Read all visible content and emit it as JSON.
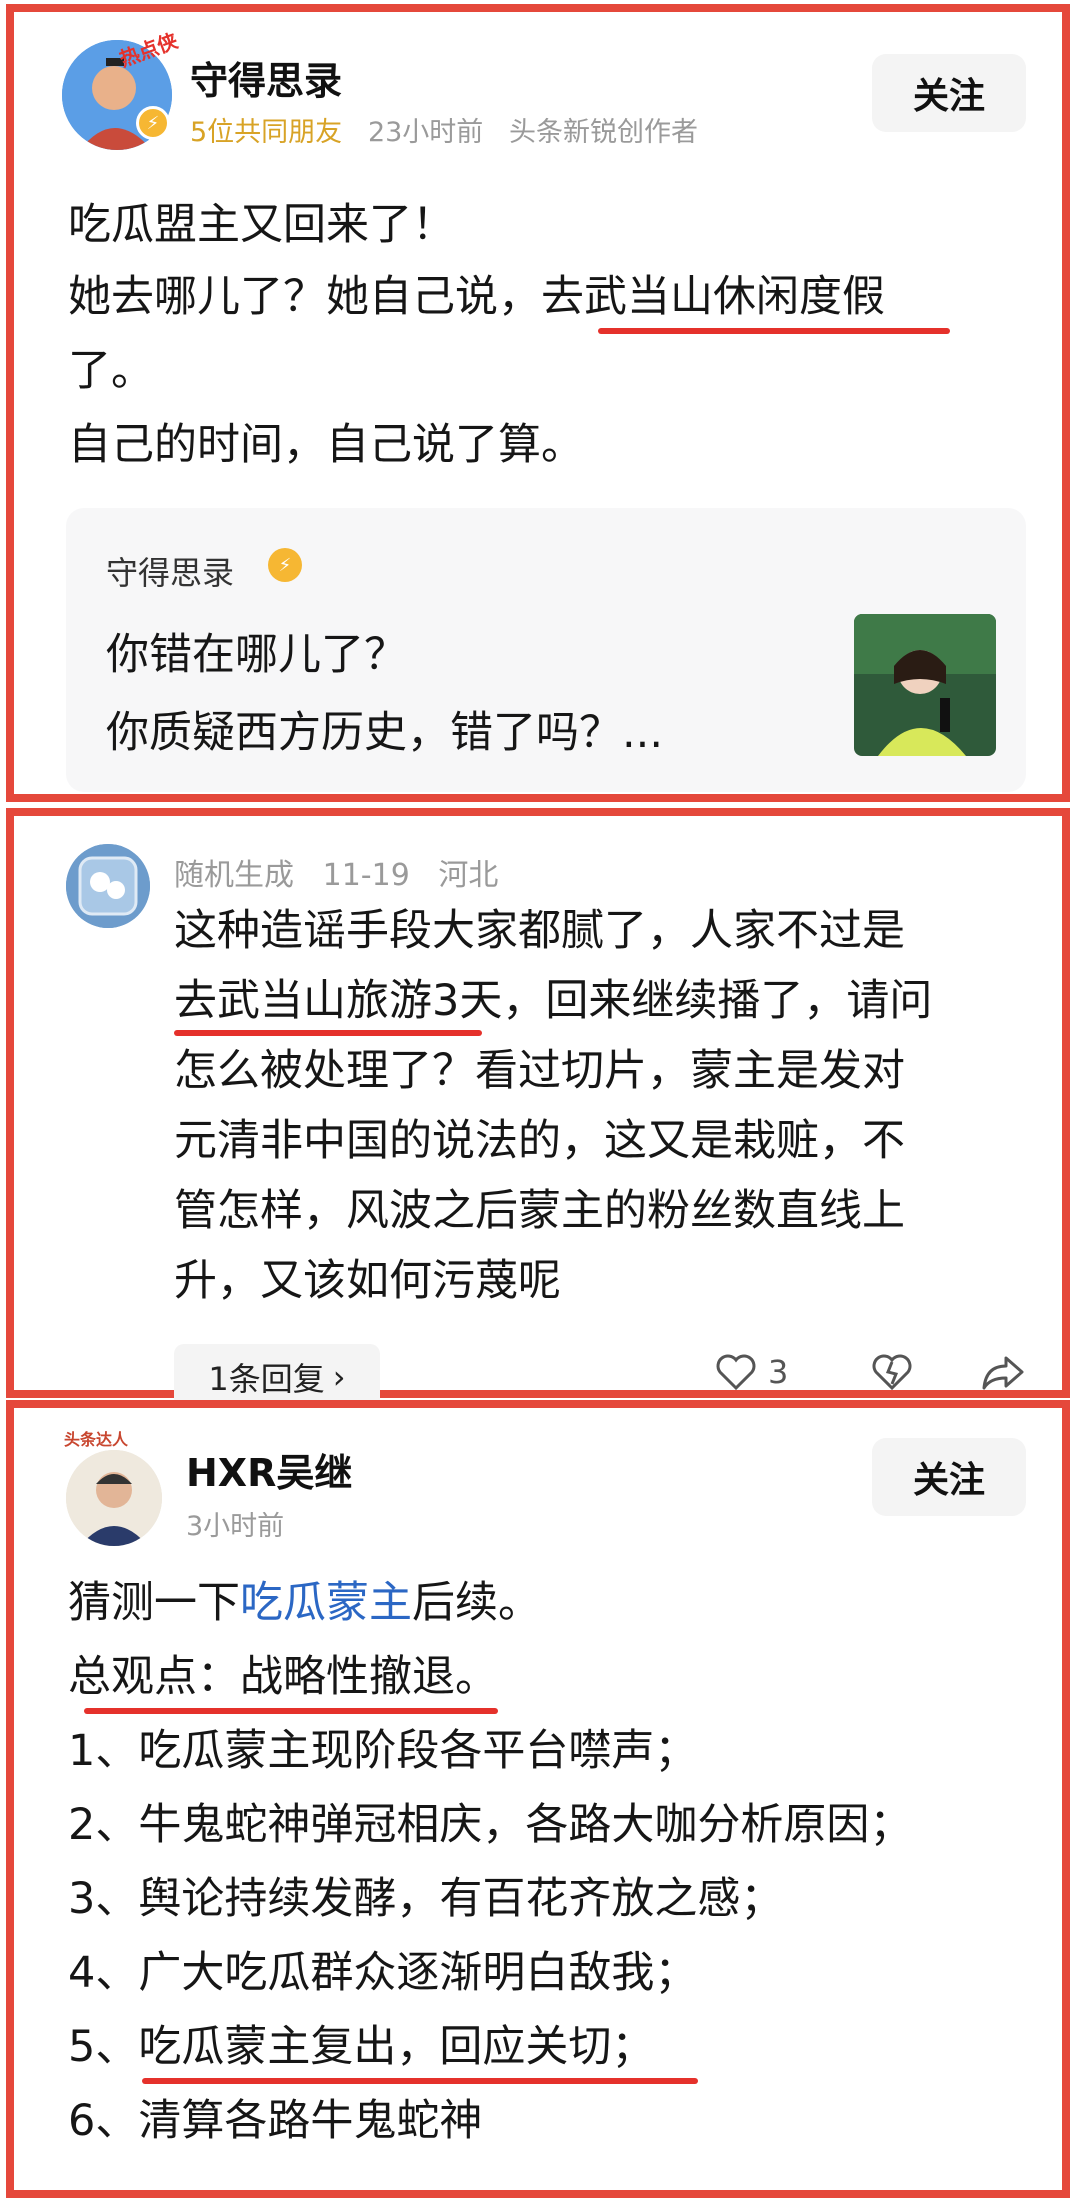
{
  "post1": {
    "author": "守得思录",
    "avatar_badge": "热点侠",
    "mutual_friends": "5位共同朋友",
    "time": "23小时前",
    "creator_label": "头条新锐创作者",
    "follow_label": "关注",
    "lines": [
      "吃瓜盟主又回来了！",
      "她去哪儿了？她自己说，去武当山休闲度假",
      "了。",
      "自己的时间，自己说了算。"
    ],
    "quote": {
      "author": "守得思录",
      "lines": [
        "你错在哪儿了？",
        "你质疑西方历史，错了吗？..."
      ]
    }
  },
  "comment": {
    "author": "随机生成",
    "date": "11-19",
    "location": "河北",
    "lines": [
      "这种造谣手段大家都腻了，人家不过是",
      "去武当山旅游3天，回来继续播了，请问",
      "怎么被处理了？看过切片，蒙主是发对",
      "元清非中国的说法的，这又是栽赃，不",
      "管怎样，风波之后蒙主的粉丝数直线上",
      "升，又该如何污蔑呢"
    ],
    "reply_label": "1条回复",
    "like_count": "3"
  },
  "post2": {
    "author": "HXR吴继",
    "avatar_badge": "头条达人",
    "time": "3小时前",
    "follow_label": "关注",
    "line0_pre": "猜测一下",
    "line0_link": "吃瓜蒙主",
    "line0_post": "后续。",
    "lines": [
      "总观点：战略性撤退。",
      "1、吃瓜蒙主现阶段各平台噤声；",
      "2、牛鬼蛇神弹冠相庆，各路大咖分析原因；",
      "3、舆论持续发酵，有百花齐放之感；",
      "4、广大吃瓜群众逐渐明白敌我；",
      "5、吃瓜蒙主复出，回应关切；",
      "6、清算各路牛鬼蛇神"
    ]
  }
}
